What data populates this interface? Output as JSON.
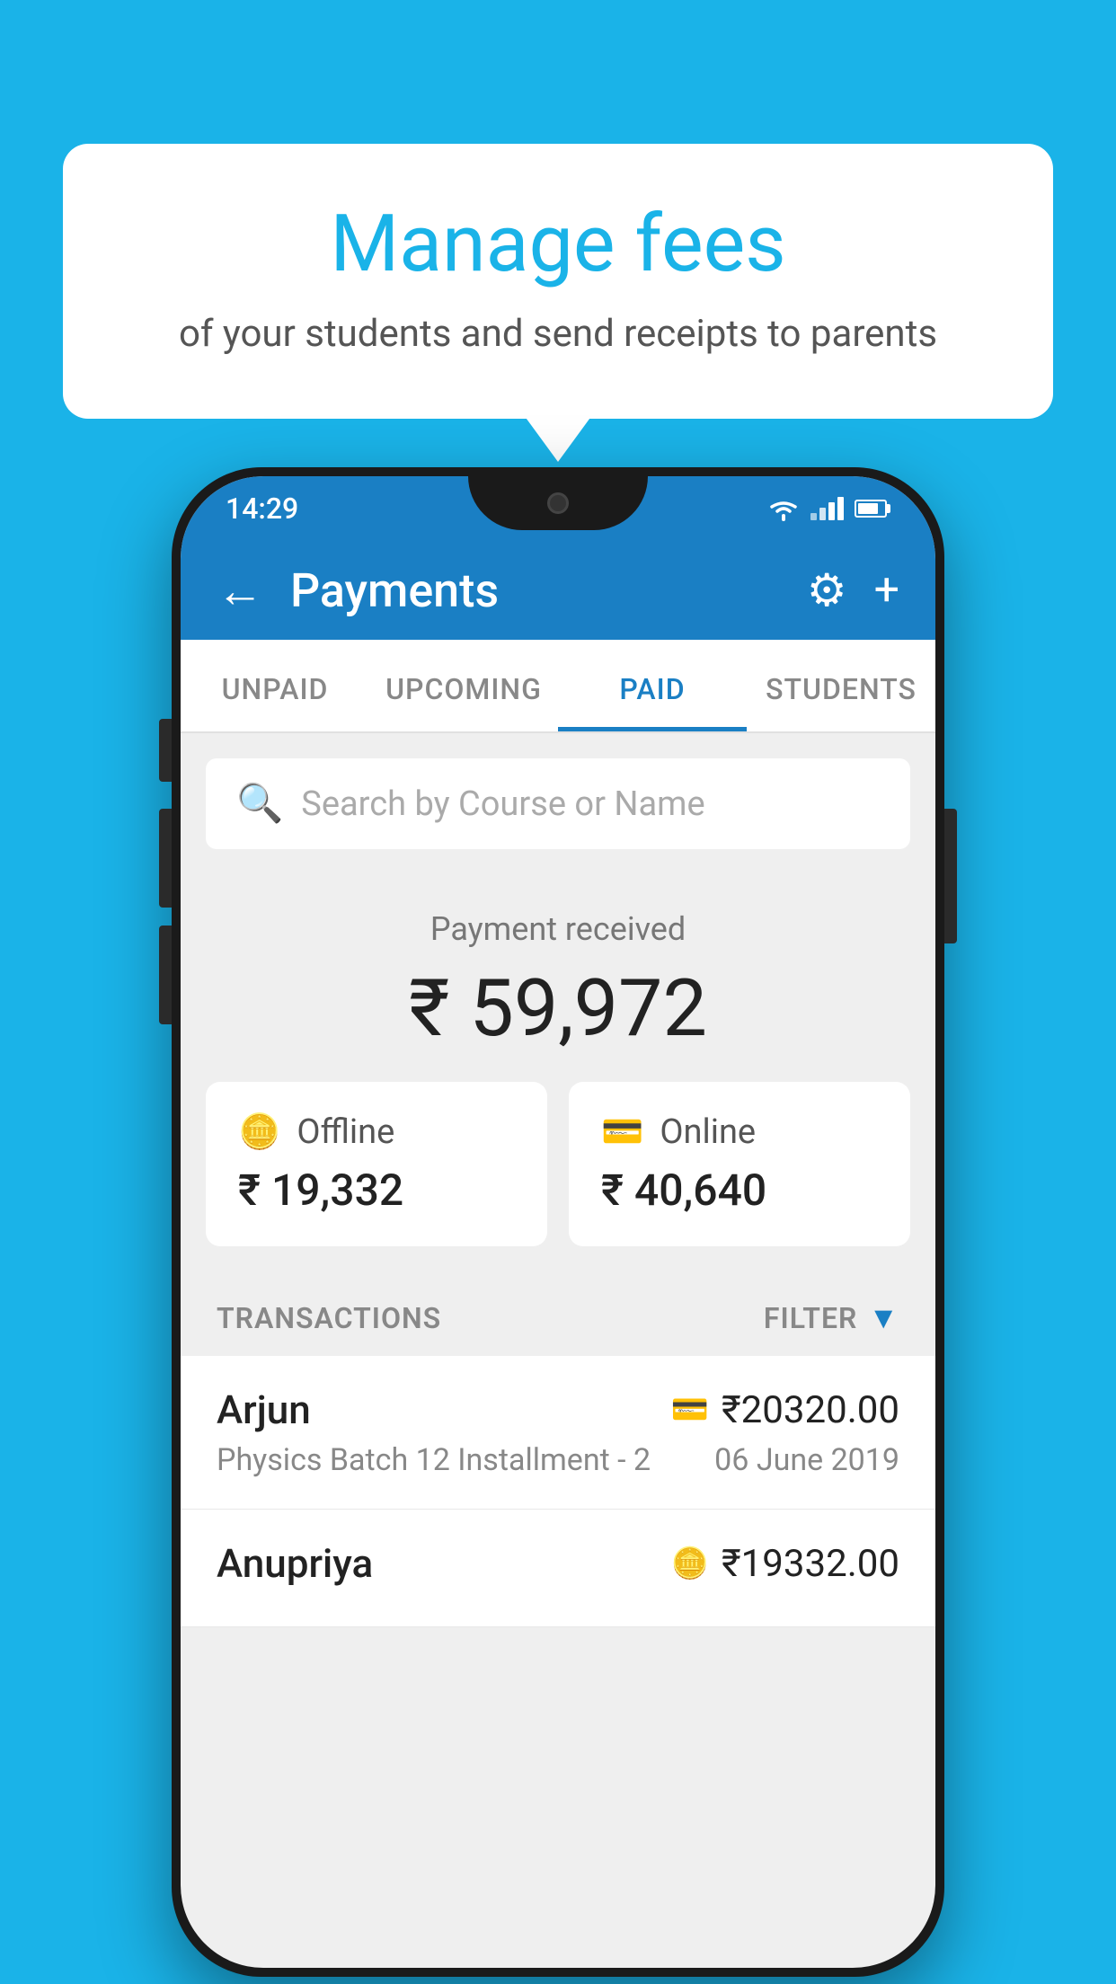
{
  "background_color": "#1ab3e8",
  "bubble": {
    "title": "Manage fees",
    "subtitle": "of your students and send receipts to parents"
  },
  "status_bar": {
    "time": "14:29",
    "wifi": true,
    "signal": true,
    "battery": true
  },
  "toolbar": {
    "title": "Payments",
    "back_label": "←",
    "settings_icon": "⚙",
    "add_icon": "+"
  },
  "tabs": [
    {
      "label": "UNPAID",
      "active": false
    },
    {
      "label": "UPCOMING",
      "active": false
    },
    {
      "label": "PAID",
      "active": true
    },
    {
      "label": "STUDENTS",
      "active": false
    }
  ],
  "search": {
    "placeholder": "Search by Course or Name"
  },
  "payment_received": {
    "label": "Payment received",
    "total": "₹ 59,972",
    "offline": {
      "label": "Offline",
      "amount": "₹ 19,332"
    },
    "online": {
      "label": "Online",
      "amount": "₹ 40,640"
    }
  },
  "transactions": {
    "label": "TRANSACTIONS",
    "filter_label": "FILTER",
    "items": [
      {
        "name": "Arjun",
        "course": "Physics Batch 12 Installment - 2",
        "amount": "₹20320.00",
        "date": "06 June 2019",
        "payment_type": "online"
      },
      {
        "name": "Anupriya",
        "course": "",
        "amount": "₹19332.00",
        "date": "",
        "payment_type": "offline"
      }
    ]
  }
}
